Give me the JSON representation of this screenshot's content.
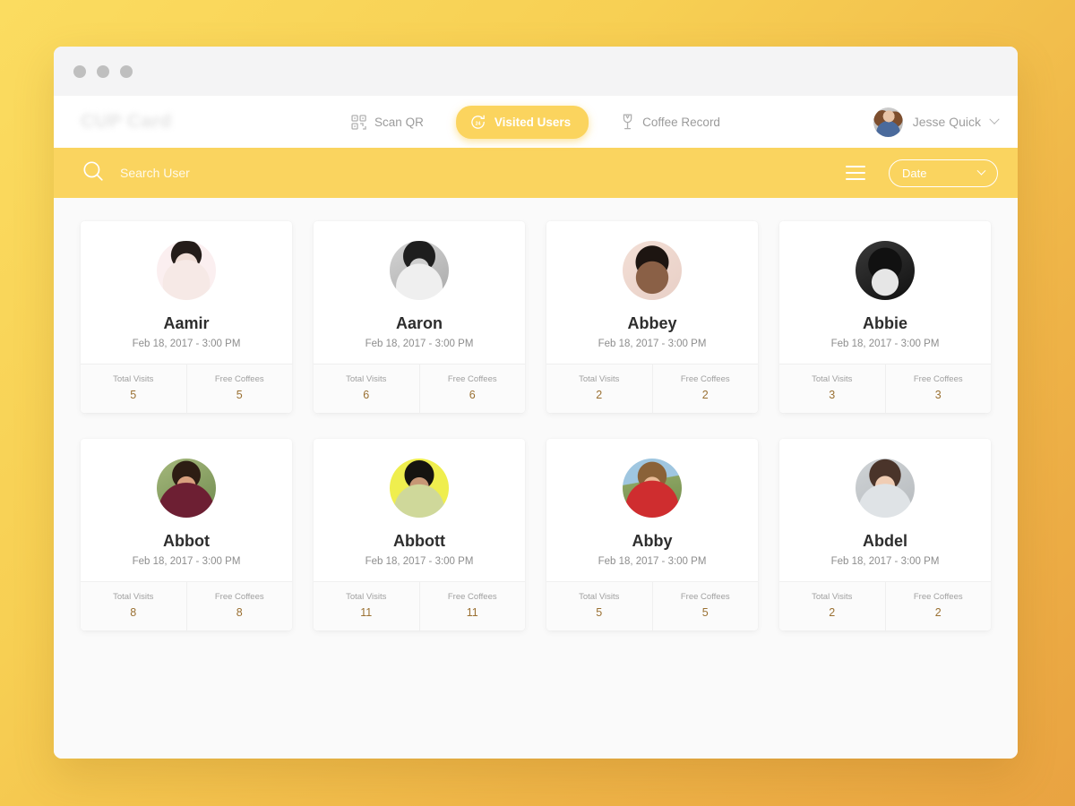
{
  "window": {
    "traffic_lights": [
      "close",
      "minimize",
      "maximize"
    ]
  },
  "header": {
    "logo": "CUP Card",
    "nav": [
      {
        "label": "Scan QR",
        "icon": "qr-code-icon",
        "active": false
      },
      {
        "label": "Visited Users",
        "icon": "refresh-coffee-icon",
        "active": true
      },
      {
        "label": "Coffee Record",
        "icon": "wine-glass-icon",
        "active": false
      }
    ],
    "profile": {
      "name": "Jesse Quick",
      "caret_icon": "chevron-down-icon"
    }
  },
  "searchbar": {
    "search_icon": "search-icon",
    "placeholder": "Search User",
    "value": "",
    "menu_icon": "hamburger-icon",
    "sort": {
      "label": "Date",
      "caret_icon": "chevron-down-icon"
    }
  },
  "colors": {
    "brand_yellow": "#FAD45F",
    "accent_pill": "#FBD45E",
    "stat_value": "#9A7032",
    "page_bg_start": "#FBDC60",
    "page_bg_end": "#E9A341"
  },
  "labels": {
    "total_visits": "Total Visits",
    "free_coffees": "Free Coffees"
  },
  "users": [
    {
      "name": "Aamir",
      "date": "Feb 18, 2017 - 3:00 PM",
      "total_visits": "5",
      "free_coffees": "5",
      "avatar": "av-aamir"
    },
    {
      "name": "Aaron",
      "date": "Feb 18, 2017 - 3:00 PM",
      "total_visits": "6",
      "free_coffees": "6",
      "avatar": "av-aaron"
    },
    {
      "name": "Abbey",
      "date": "Feb 18, 2017 - 3:00 PM",
      "total_visits": "2",
      "free_coffees": "2",
      "avatar": "av-abbey"
    },
    {
      "name": "Abbie",
      "date": "Feb 18, 2017 - 3:00 PM",
      "total_visits": "3",
      "free_coffees": "3",
      "avatar": "av-abbie"
    },
    {
      "name": "Abbot",
      "date": "Feb 18, 2017 - 3:00 PM",
      "total_visits": "8",
      "free_coffees": "8",
      "avatar": "av-abbot"
    },
    {
      "name": "Abbott",
      "date": "Feb 18, 2017 - 3:00 PM",
      "total_visits": "11",
      "free_coffees": "11",
      "avatar": "av-abbott"
    },
    {
      "name": "Abby",
      "date": "Feb 18, 2017 - 3:00 PM",
      "total_visits": "5",
      "free_coffees": "5",
      "avatar": "av-abby"
    },
    {
      "name": "Abdel",
      "date": "Feb 18, 2017 - 3:00 PM",
      "total_visits": "2",
      "free_coffees": "2",
      "avatar": "av-abdel"
    }
  ]
}
